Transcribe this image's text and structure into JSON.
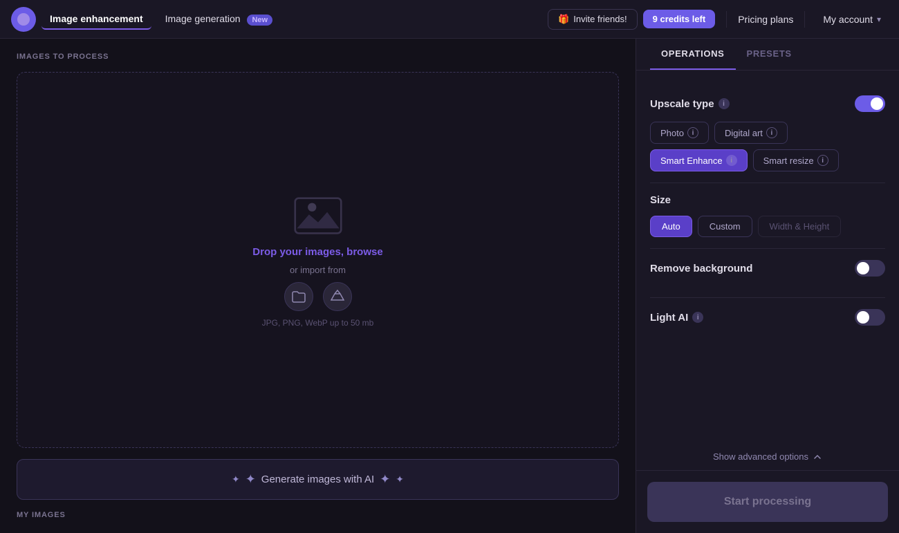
{
  "app": {
    "logo_label": "App Logo"
  },
  "header": {
    "nav_image_enhancement": "Image enhancement",
    "nav_image_generation": "Image generation",
    "nav_badge": "New",
    "invite_icon": "🎁",
    "invite_label": "Invite friends!",
    "credits_count": "9",
    "credits_label": "credits left",
    "pricing_label": "Pricing plans",
    "account_label": "My account",
    "chevron": "▾"
  },
  "left": {
    "images_section_label": "IMAGES TO PROCESS",
    "drop_text_before_link": "Drop your images, ",
    "drop_link": "browse",
    "import_text": "or import from",
    "file_types": "JPG, PNG, WebP up to 50 mb",
    "generate_sparkle1": "✦",
    "generate_sparkle2": "✦",
    "generate_sparkle3": "✦",
    "generate_sparkle4": "✦",
    "generate_label": "Generate images with AI",
    "my_images_label": "MY IMAGES"
  },
  "right": {
    "tab_operations": "OPERATIONS",
    "tab_presets": "PRESETS",
    "upscale_section": {
      "title": "Upscale type",
      "toggle_state": "on",
      "type_buttons": [
        {
          "id": "photo",
          "label": "Photo",
          "active": false
        },
        {
          "id": "digital_art",
          "label": "Digital art",
          "active": false
        },
        {
          "id": "smart_enhance",
          "label": "Smart Enhance",
          "active": true
        },
        {
          "id": "smart_resize",
          "label": "Smart resize",
          "active": false
        }
      ]
    },
    "size_section": {
      "title": "Size",
      "size_buttons": [
        {
          "id": "auto",
          "label": "Auto",
          "active": true
        },
        {
          "id": "custom",
          "label": "Custom",
          "active": false
        },
        {
          "id": "wh",
          "label": "Width & Height",
          "active": false,
          "muted": true
        }
      ]
    },
    "remove_bg_section": {
      "title": "Remove background",
      "toggle_state": "off"
    },
    "light_ai_section": {
      "title": "Light AI",
      "toggle_state": "off"
    },
    "show_advanced_label": "Show advanced options",
    "start_btn_label": "Start processing"
  }
}
